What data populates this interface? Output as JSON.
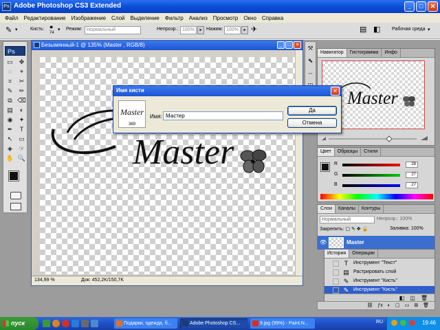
{
  "app": {
    "title": "Adobe Photoshop CS3 Extended",
    "ps_mini": "Ps",
    "min": "_",
    "max": "□",
    "close": "✕"
  },
  "menu": [
    "Файл",
    "Редактирование",
    "Изображение",
    "Слой",
    "Выделение",
    "Фильтр",
    "Анализ",
    "Просмотр",
    "Окно",
    "Справка"
  ],
  "options": {
    "brush_label": "Кисть:",
    "brush_size": "74",
    "mode_label": "Режим:",
    "mode_value": "Нормальный",
    "opacity_label": "Непрозр.:",
    "opacity_value": "100%",
    "flow_label": "Нажим:",
    "flow_value": "100%",
    "workspace_label": "Рабочая среда"
  },
  "toolbox": {
    "logo": "Ps",
    "tools": [
      "▭",
      "✥",
      "◌",
      "⌖",
      "⌗",
      "✂",
      "✎",
      "✏",
      "⧉",
      "⌫",
      "▤",
      "◐",
      "◉",
      "✦",
      "✒",
      "T",
      "↖",
      "▭",
      "◈",
      "☞",
      "✋",
      "🔍"
    ]
  },
  "document": {
    "title": "Безымянный-1 @ 135% (Master , RGB/8)",
    "zoom": "134,99 %",
    "docsize": "Док: 452,2K/150,7K",
    "art_text": "Master"
  },
  "dock_icons": [
    "⚒",
    "⬉",
    "⇔",
    "◫",
    "✉",
    "⚙"
  ],
  "navigator": {
    "tabs": [
      "Навигатор",
      "Гистограмма",
      "Инфо"
    ],
    "art_text": "Master"
  },
  "color": {
    "tabs": [
      "Цвет",
      "Образцы",
      "Стили"
    ],
    "channels": [
      {
        "label": "R",
        "value": "28",
        "color": "#e03030"
      },
      {
        "label": "G",
        "value": "27",
        "color": "#30b030"
      },
      {
        "label": "B",
        "value": "27",
        "color": "#3050e0"
      }
    ]
  },
  "layers": {
    "tabs": [
      "Слои",
      "Каналы",
      "Контуры"
    ],
    "blend": "Нормальный",
    "opacity_label": "Непрозр.:",
    "opacity_value": "100%",
    "lock_label": "Закрепить:",
    "fill_label": "Заливка:",
    "fill_value": "100%",
    "layer_name": "Master",
    "buttons": [
      "ƒx",
      "◐",
      "▢",
      "▭",
      "⊞",
      "🗑"
    ]
  },
  "history": {
    "tabs": [
      "История",
      "Операции"
    ],
    "items": [
      {
        "icon": "T",
        "label": "Инструмент \"Текст\"",
        "selected": false
      },
      {
        "icon": "▤",
        "label": "Растрировать слой",
        "selected": false
      },
      {
        "icon": "✎",
        "label": "Инструмент \"Кисть\"",
        "selected": false
      },
      {
        "icon": "✎",
        "label": "Инструмент \"Кисть\"",
        "selected": true
      }
    ],
    "buttons": [
      "◧",
      "◫",
      "🗑"
    ]
  },
  "dialog": {
    "title": "Имя кисти",
    "preview_text": "Master",
    "preview_num": "369",
    "name_label": "Имя:",
    "name_value": "Мастер",
    "ok": "Да",
    "cancel": "Отмена"
  },
  "taskbar": {
    "start": "пуск",
    "tasks": [
      {
        "label": "Подарки, одежда, б...",
        "active": false,
        "color": "#e07020"
      },
      {
        "label": "Adobe Photoshop CS...",
        "active": true,
        "color": "#1d3a78"
      },
      {
        "label": "9.jpg (99%) - Paint.N...",
        "active": false,
        "color": "#d83020"
      }
    ],
    "lang": "RU",
    "clock": "19:46"
  }
}
